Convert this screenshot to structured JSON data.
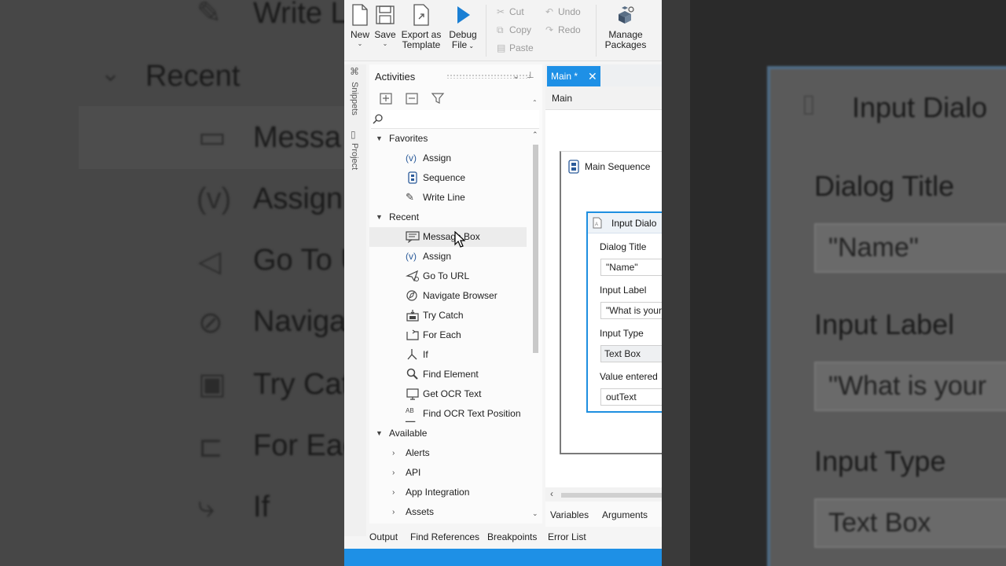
{
  "background_left": {
    "items": [
      {
        "label": "Write L",
        "icon": "write-line-icon"
      },
      {
        "label": "Recent",
        "icon": "chevron-down-icon"
      },
      {
        "label": "Messa",
        "icon": "message-box-icon"
      },
      {
        "label": "Assign",
        "icon": "assign-icon"
      },
      {
        "label": "Go To U",
        "icon": "go-to-url-icon"
      },
      {
        "label": "Naviga",
        "icon": "navigate-browser-icon"
      },
      {
        "label": "Try Cat",
        "icon": "try-catch-icon"
      },
      {
        "label": "For Eac",
        "icon": "for-each-icon"
      },
      {
        "label": "If",
        "icon": "if-icon"
      }
    ]
  },
  "background_right": {
    "title": "Input Dialo",
    "fields": [
      {
        "label": "Dialog Title",
        "value": "\"Name\""
      },
      {
        "label": "Input Label",
        "value": "\"What is your"
      },
      {
        "label": "Input Type",
        "value": "Text Box"
      }
    ]
  },
  "ribbon": {
    "new": "New",
    "save": "Save",
    "export_line1": "Export as",
    "export_line2": "Template",
    "debug_line1": "Debug",
    "debug_line2": "File",
    "cut": "Cut",
    "copy": "Copy",
    "paste": "Paste",
    "undo": "Undo",
    "redo": "Redo",
    "manage_line1": "Manage",
    "manage_line2": "Packages"
  },
  "side_tabs": {
    "snippets": "Snippets",
    "project": "Project"
  },
  "activities": {
    "title": "Activities",
    "favorites_header": "Favorites",
    "favorites": [
      {
        "label": "Assign",
        "icon": "assign-icon"
      },
      {
        "label": "Sequence",
        "icon": "sequence-icon"
      },
      {
        "label": "Write Line",
        "icon": "write-line-icon"
      }
    ],
    "recent_header": "Recent",
    "recent": [
      {
        "label": "Message Box",
        "icon": "message-box-icon"
      },
      {
        "label": "Assign",
        "icon": "assign-icon"
      },
      {
        "label": "Go To URL",
        "icon": "go-to-url-icon"
      },
      {
        "label": "Navigate Browser",
        "icon": "navigate-browser-icon"
      },
      {
        "label": "Try Catch",
        "icon": "try-catch-icon"
      },
      {
        "label": "For Each",
        "icon": "for-each-icon"
      },
      {
        "label": "If",
        "icon": "if-icon"
      },
      {
        "label": "Find Element",
        "icon": "find-element-icon"
      },
      {
        "label": "Get OCR Text",
        "icon": "get-ocr-text-icon"
      },
      {
        "label": "Find OCR Text Position",
        "icon": "find-ocr-text-position-icon"
      }
    ],
    "available_header": "Available",
    "available": [
      {
        "label": "Alerts"
      },
      {
        "label": "API"
      },
      {
        "label": "App Integration"
      },
      {
        "label": "Assets"
      }
    ]
  },
  "designer": {
    "tab_label": "Main *",
    "breadcrumb": "Main",
    "sequence_title": "Main Sequence",
    "dialog_title": "Input Dialo",
    "fields": [
      {
        "label": "Dialog Title",
        "value": "\"Name\""
      },
      {
        "label": "Input Label",
        "value": "\"What is your"
      },
      {
        "label": "Input Type",
        "value": "Text Box"
      },
      {
        "label": "Value entered",
        "value": "outText"
      }
    ],
    "variables_tab": "Variables",
    "arguments_tab": "Arguments"
  },
  "bottom_panels": {
    "output": "Output",
    "find_references": "Find References",
    "breakpoints": "Breakpoints",
    "error_list": "Error List"
  },
  "colors": {
    "accent": "#1e90e6",
    "debug_play": "#1a7fd4"
  }
}
